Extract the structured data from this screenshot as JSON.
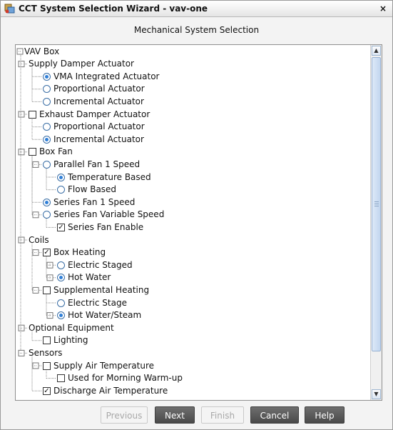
{
  "window": {
    "title": "CCT System Selection Wizard - vav-one",
    "close_glyph": "×"
  },
  "section_title": "Mechanical System Selection",
  "tree": [
    {
      "label": "VAV Box",
      "control": "none"
    },
    {
      "label": "Supply Damper Actuator",
      "control": "none"
    },
    {
      "label": "VMA Integrated Actuator",
      "control": "radio",
      "selected": true
    },
    {
      "label": "Proportional Actuator",
      "control": "radio",
      "selected": false
    },
    {
      "label": "Incremental Actuator",
      "control": "radio",
      "selected": false
    },
    {
      "label": "Exhaust Damper Actuator",
      "control": "checkbox",
      "checked": false
    },
    {
      "label": "Proportional Actuator",
      "control": "radio",
      "selected": false
    },
    {
      "label": "Incremental Actuator",
      "control": "radio",
      "selected": true
    },
    {
      "label": "Box Fan",
      "control": "checkbox",
      "checked": false
    },
    {
      "label": "Parallel Fan 1 Speed",
      "control": "radio",
      "selected": false
    },
    {
      "label": "Temperature Based",
      "control": "radio",
      "selected": true
    },
    {
      "label": "Flow Based",
      "control": "radio",
      "selected": false
    },
    {
      "label": "Series Fan 1 Speed",
      "control": "radio",
      "selected": true
    },
    {
      "label": "Series Fan Variable Speed",
      "control": "radio",
      "selected": false
    },
    {
      "label": "Series Fan Enable",
      "control": "checkbox",
      "checked": true
    },
    {
      "label": "Coils",
      "control": "none"
    },
    {
      "label": "Box Heating",
      "control": "checkbox",
      "checked": true
    },
    {
      "label": "Electric Staged",
      "control": "radio",
      "selected": false
    },
    {
      "label": "Hot Water",
      "control": "radio",
      "selected": true
    },
    {
      "label": "Supplemental Heating",
      "control": "checkbox",
      "checked": false
    },
    {
      "label": "Electric Stage",
      "control": "radio",
      "selected": false
    },
    {
      "label": "Hot Water/Steam",
      "control": "radio",
      "selected": true
    },
    {
      "label": "Optional Equipment",
      "control": "none"
    },
    {
      "label": "Lighting",
      "control": "checkbox",
      "checked": false
    },
    {
      "label": "Sensors",
      "control": "none"
    },
    {
      "label": "Supply Air Temperature",
      "control": "checkbox",
      "checked": false
    },
    {
      "label": "Used for Morning Warm-up",
      "control": "checkbox",
      "checked": false
    },
    {
      "label": "Discharge Air Temperature",
      "control": "checkbox",
      "checked": true
    }
  ],
  "scrollbar": {
    "up_glyph": "▲",
    "down_glyph": "▼"
  },
  "buttons": [
    {
      "label": "Previous",
      "enabled": false
    },
    {
      "label": "Next",
      "enabled": true
    },
    {
      "label": "Finish",
      "enabled": false
    },
    {
      "label": "Cancel",
      "enabled": true
    },
    {
      "label": "Help",
      "enabled": true
    }
  ],
  "colors": {
    "radio_selected": "#2F7FD8",
    "button_active": "#555555",
    "tree_line": "#8A8A8A"
  }
}
